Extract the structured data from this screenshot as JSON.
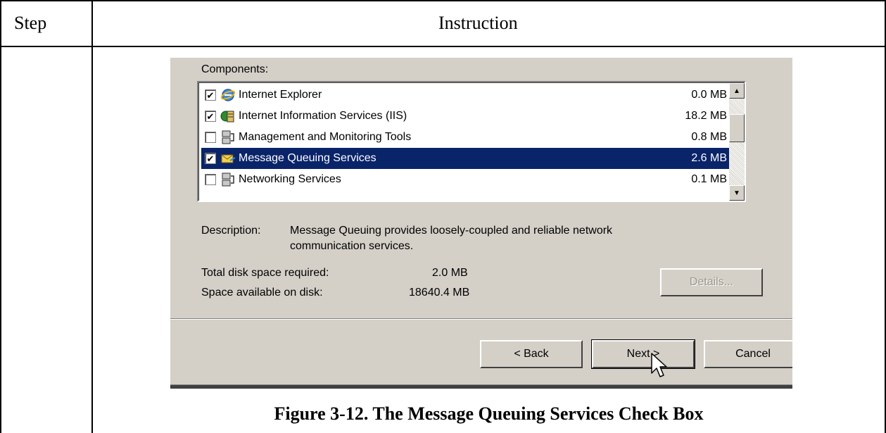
{
  "table": {
    "col_step": "Step",
    "col_instruction": "Instruction"
  },
  "dialog": {
    "components_label": "Components:",
    "components": [
      {
        "name": "Internet Explorer",
        "size": "0.0 MB",
        "checked": true,
        "selected": false,
        "icon": "internet-explorer-icon"
      },
      {
        "name": "Internet Information Services (IIS)",
        "size": "18.2 MB",
        "checked": true,
        "selected": false,
        "icon": "iis-icon"
      },
      {
        "name": "Management and Monitoring Tools",
        "size": "0.8 MB",
        "checked": false,
        "selected": false,
        "icon": "tools-icon"
      },
      {
        "name": "Message Queuing Services",
        "size": "2.6 MB",
        "checked": true,
        "selected": true,
        "icon": "message-queuing-icon"
      },
      {
        "name": "Networking Services",
        "size": "0.1 MB",
        "checked": false,
        "selected": false,
        "icon": "networking-icon"
      }
    ],
    "description_label": "Description:",
    "description_line1": "Message Queuing provides loosely-coupled and reliable network",
    "description_line2": "communication services.",
    "total_label": "Total disk space required:",
    "total_value": "2.0 MB",
    "available_label": "Space available on disk:",
    "available_value": "18640.4 MB",
    "details_button": "Details...",
    "back_button": "< Back",
    "next_button": "Next >",
    "cancel_button": "Cancel"
  },
  "caption": "Figure 3-12.  The Message Queuing Services Check Box",
  "colors": {
    "dialog_bg": "#d4d0c8",
    "selection": "#0a246a"
  }
}
